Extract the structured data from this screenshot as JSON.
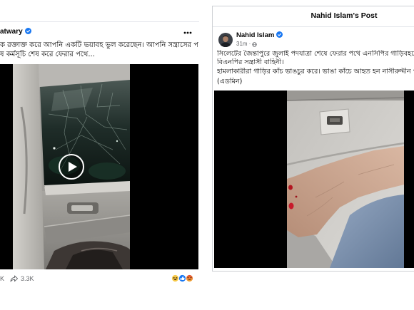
{
  "colors": {
    "brand_blue": "#1877f2",
    "primary_text": "#050505",
    "secondary_text": "#65676b"
  },
  "left_post": {
    "author": "atwary",
    "verified_icon": "verified-badge-icon",
    "more_icon": "more-dots-icon",
    "text_lines": [
      "ক রক্তাক্ত করে আপনি একটি ভয়াবহ ভুল করেছেন। আপনি সন্ত্রাসের পথে গেলেন।",
      "ষ কর্মসূচি শেষ করে ফেরার পথে..."
    ],
    "play_icon": "play-icon",
    "comment_count": "K",
    "share_icon": "share-icon",
    "share_count": "3.3K",
    "reaction_icons": [
      "haha-icon",
      "like-icon",
      "angry-icon"
    ]
  },
  "right_post": {
    "dialog_title": "Nahid Islam's Post",
    "author": "Nahid Islam",
    "verified_icon": "verified-badge-icon",
    "time": "31m",
    "meta_separator": "·",
    "privacy_icon": "globe-icon",
    "text_lines": [
      "সিলেটের জৈন্তাপুরে জুলাই পদযাত্রা শেষে ফেরার পথে এনসিপির গাড়িবহরে আবারও",
      "বিএনপির সন্ত্রাসী বাহিনী।",
      "হামলাকারীরা গাড়ির কাঁচ ভাঙচুর করে। ভাঙা কাঁচে আহত হন নাসীরুদ্দীন পাটওয়ারী",
      "(এডমিন)"
    ]
  }
}
